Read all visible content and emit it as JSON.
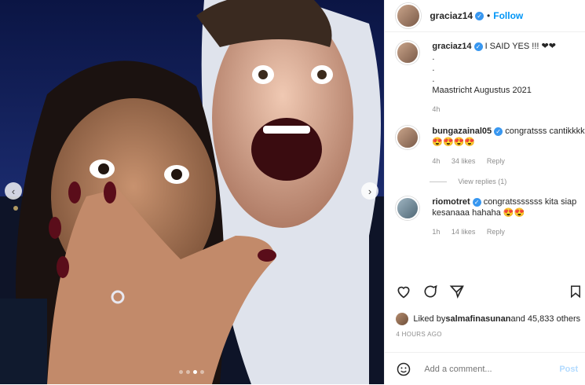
{
  "post": {
    "username": "graciaz14",
    "follow_label": "Follow",
    "separator": "•"
  },
  "caption": {
    "username": "graciaz14",
    "lines": [
      "I SAID YES !!! ❤❤",
      ".",
      ".",
      ".",
      "Maastricht Augustus 2021"
    ],
    "time": "4h"
  },
  "comments": [
    {
      "username": "bungazainal05",
      "text": "congratsss cantikkkk 😍😍😍😍",
      "time": "4h",
      "likes": "34 likes",
      "reply": "Reply",
      "view_replies": "View replies (1)"
    },
    {
      "username": "riomotret",
      "text": "congratsssssss kita siap kesanaaa hahaha 😍😍",
      "time": "1h",
      "likes": "14 likes",
      "reply": "Reply"
    }
  ],
  "likes": {
    "text_prefix": "Liked by ",
    "liker": "salmafinasunan",
    "text_suffix": " and 45,833 others"
  },
  "timestamp": "4 HOURS AGO",
  "add_comment": {
    "placeholder": "Add a comment...",
    "post_label": "Post"
  },
  "carousel": {
    "left_arrow": "‹",
    "right_arrow": "›",
    "total": 4,
    "active_index": 2
  },
  "icons": [
    "heart-icon",
    "comment-icon",
    "share-icon",
    "bookmark-icon",
    "emoji-icon",
    "verified-icon"
  ],
  "colors": {
    "follow": "#0095f6",
    "verified": "#3897f0",
    "muted": "#8e8e8e"
  }
}
